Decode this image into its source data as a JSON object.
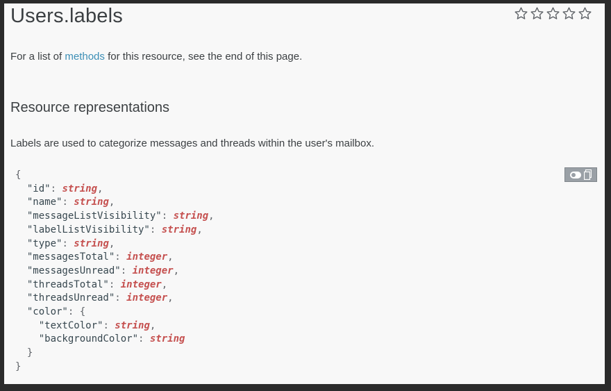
{
  "page": {
    "title": "Users.labels"
  },
  "rating": {
    "stars": 5,
    "icon": "star-outline-icon"
  },
  "intro": {
    "prefix": "For a list of ",
    "link_text": "methods",
    "suffix": " for this resource, see the end of this page."
  },
  "section": {
    "heading": "Resource representations",
    "description": "Labels are used to categorize messages and threads within the user's mailbox."
  },
  "code": {
    "open": "{",
    "close": "}",
    "fields": [
      {
        "key": "\"id\"",
        "type": "string",
        "sep": ","
      },
      {
        "key": "\"name\"",
        "type": "string",
        "sep": ","
      },
      {
        "key": "\"messageListVisibility\"",
        "type": "string",
        "sep": ","
      },
      {
        "key": "\"labelListVisibility\"",
        "type": "string",
        "sep": ","
      },
      {
        "key": "\"type\"",
        "type": "string",
        "sep": ","
      },
      {
        "key": "\"messagesTotal\"",
        "type": "integer",
        "sep": ","
      },
      {
        "key": "\"messagesUnread\"",
        "type": "integer",
        "sep": ","
      },
      {
        "key": "\"threadsTotal\"",
        "type": "integer",
        "sep": ","
      },
      {
        "key": "\"threadsUnread\"",
        "type": "integer",
        "sep": ","
      }
    ],
    "nested": {
      "key": "\"color\"",
      "open": "{",
      "close": "}",
      "fields": [
        {
          "key": "\"textColor\"",
          "type": "string",
          "sep": ","
        },
        {
          "key": "\"backgroundColor\"",
          "type": "string",
          "sep": ""
        }
      ]
    }
  },
  "toolbar": {
    "toggle_icon": "toggle-icon",
    "copy_icon": "copy-icon"
  },
  "colors": {
    "link": "#3d8fb6",
    "type": "#c5504f",
    "text": "#3c4043",
    "background": "#f8f8f8"
  }
}
